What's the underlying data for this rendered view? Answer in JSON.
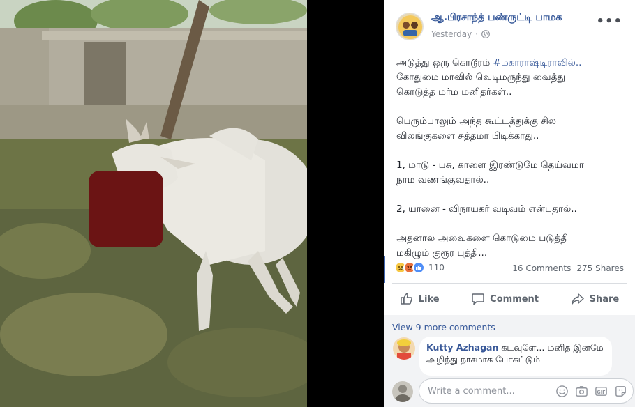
{
  "post": {
    "author": "ஆ.பிரசாந்த் பண்ருட்டி பாமக",
    "timestamp": "Yesterday",
    "privacy_icon": "globe-icon",
    "more_label": "•••",
    "text": {
      "line1_prefix": "அடுத்து ஒரு கொடூரம் ",
      "line1_hashtag": "#மகாராஷ்டிராவில்..",
      "line2": "கோதுமை மாவில் வெடிமருந்து வைத்து",
      "line3": "கொடுத்த மர்ம மனிதர்கள்..",
      "para2_line1": "பெரும்பாலும் அந்த கூட்டத்துக்கு சில",
      "para2_line2": "விலங்குகளை சுத்தமா பிடிக்காது..",
      "para3_line1": "1, மாடு - பசு, காளை இரண்டுமே தெய்வமா",
      "para3_line2": "நாம வணங்குவதால்..",
      "para4": "2, யானை - விநாயகர் வடிவம் என்பதால்..",
      "para5_line1": "அதனால அவைகளை கொடுமை படுத்தி",
      "para5_line2": "மகிழும் குரூர புத்தி..."
    }
  },
  "stats": {
    "reaction_count": "110",
    "comments": "16 Comments",
    "shares": "275 Shares"
  },
  "actions": {
    "like": "Like",
    "comment": "Comment",
    "share": "Share"
  },
  "comments": {
    "view_more": "View 9 more comments",
    "items": [
      {
        "name": "Kutty Azhagan",
        "text": "கடவுளே... மனித இனமே அழிந்து நாசமாக போகட்டும்"
      }
    ],
    "placeholder": "Write a comment..."
  },
  "colors": {
    "link": "#365899",
    "facebook_blue": "#4267b2",
    "redaction": "#6b1414"
  }
}
